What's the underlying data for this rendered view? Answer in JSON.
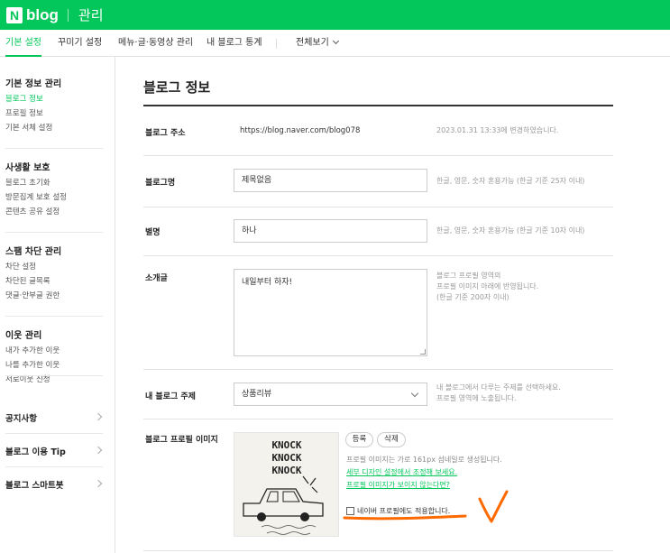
{
  "header": {
    "logo_letter": "N",
    "logo_word": "blog",
    "title": "관리"
  },
  "nav": {
    "tabs": [
      {
        "label": "기본 설정",
        "active": true
      },
      {
        "label": "꾸미기 설정"
      },
      {
        "label": "메뉴·글·동영상 관리"
      },
      {
        "label": "내 블로그 통계"
      },
      {
        "label": "전체보기"
      }
    ]
  },
  "sidebar": {
    "groups": [
      {
        "title": "기본 정보 관리",
        "items": [
          "블로그 정보",
          "프로필 정보",
          "기본 서체 설정"
        ]
      },
      {
        "title": "사생활 보호",
        "items": [
          "블로그 초기화",
          "방문집계 보호 설정",
          "콘텐츠 공유 설정"
        ]
      },
      {
        "title": "스팸 차단 관리",
        "items": [
          "차단 설정",
          "차단된 글목록",
          "댓글·안부글 권한"
        ]
      },
      {
        "title": "이웃 관리",
        "items": [
          "내가 추가한 이웃",
          "나를 추가한 이웃",
          "서로이웃 신청"
        ]
      }
    ],
    "links": [
      "공지사항",
      "블로그 이용 Tip",
      "블로그 스마트봇"
    ]
  },
  "main": {
    "title": "블로그 정보",
    "address": {
      "label": "블로그 주소",
      "value": "https://blog.naver.com/blog078",
      "note": "2023.01.31 13:33에 변경하였습니다."
    },
    "blog_name": {
      "label": "블로그명",
      "value": "제목없음",
      "help": "한글, 영문, 숫자 혼용가능 (한글 기준 25자 이내)"
    },
    "nickname": {
      "label": "별명",
      "value": "하나",
      "help": "한글, 영문, 숫자 혼용가능 (한글 기준 10자 이내)"
    },
    "intro": {
      "label": "소개글",
      "value": "내일부터 하자!",
      "help": [
        "블로그 프로필 영역의",
        "프로필 이미지 아래에 반영됩니다.",
        "(한글 기준 200자 이내)"
      ]
    },
    "topic": {
      "label": "내 블로그 주제",
      "value": "상품리뷰",
      "help": [
        "내 블로그에서 다루는 주제를 선택하세요.",
        "프로필 영역에 노출됩니다."
      ]
    },
    "profile_image": {
      "label": "블로그 프로필 이미지",
      "register_button": "등록",
      "delete_button": "삭제",
      "size_note": "프로필 이미지는 가로 161px 섬네일로 생성됩니다.",
      "design_link": "세부 디자인 설정에서 조정해 보세요.",
      "not_showing_link": "프로필 이미지가 보이지 않는다면?",
      "checkbox_label": "네이버 프로필에도 적용합니다.",
      "checked": false,
      "drawing_text": [
        "KNOCK",
        "KNOCK",
        "KNOCK"
      ]
    }
  },
  "colors": {
    "brand": "#03c75a",
    "annotation": "#ff6a00"
  }
}
